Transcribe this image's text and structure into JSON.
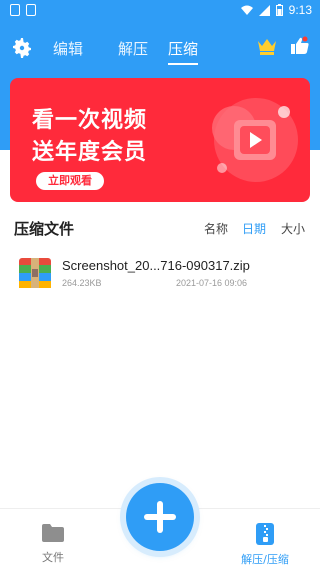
{
  "status_bar": {
    "time": "9:13"
  },
  "topbar": {
    "tabs": [
      {
        "label": "编辑"
      },
      {
        "label": "解压"
      },
      {
        "label": "压缩"
      }
    ],
    "active_tab": "压缩"
  },
  "banner": {
    "line1": "看一次视频",
    "line2": "送年度会员",
    "cta": "立即观看"
  },
  "section": {
    "title": "压缩文件",
    "sort_options": [
      "名称",
      "日期",
      "大小"
    ],
    "active_sort": "日期"
  },
  "files": [
    {
      "name": "Screenshot_20...716-090317.zip",
      "size": "264.23KB",
      "date": "2021-07-16 09:06"
    }
  ],
  "bottom_nav": {
    "files_label": "文件",
    "zip_label": "解压/压缩"
  },
  "colors": {
    "primary": "#2f9df6",
    "banner": "#ff2a3b"
  },
  "icons": [
    "gear-icon",
    "crown-icon",
    "thumbs-up-icon",
    "zip-archive-icon",
    "folder-icon",
    "zip-file-icon",
    "plus-icon"
  ]
}
